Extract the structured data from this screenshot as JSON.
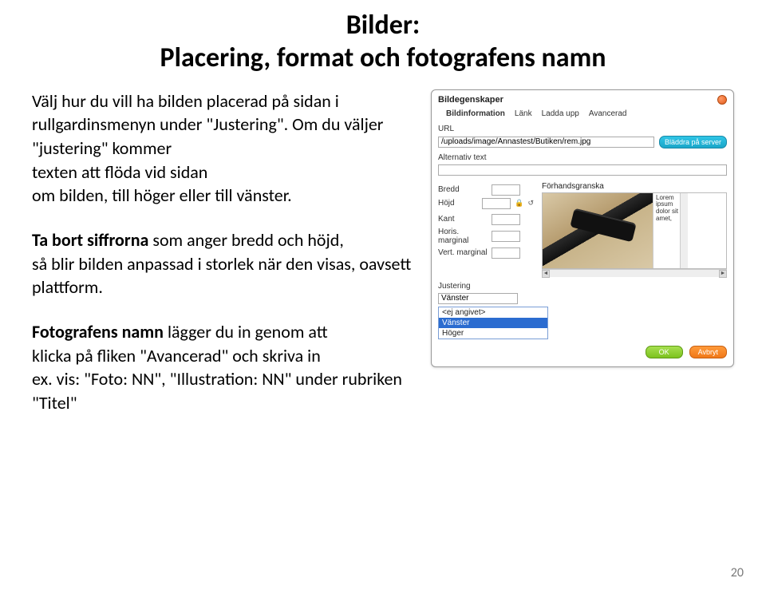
{
  "title": {
    "line1": "Bilder:",
    "line2": "Placering, format och fotografens namn"
  },
  "body": {
    "p1_plain_a": "Välj hur du vill ha bilden placerad på sidan i rullgardinsmenyn under \"Justering\". Om du väljer \"justering\" kommer",
    "p1_plain_b": "texten att flöda vid sidan",
    "p1_plain_c": "om bilden, till höger eller till vänster.",
    "p2_bold": "Ta bort siffrorna",
    "p2_rest_a": " som anger bredd och höjd,",
    "p2_rest_b": "så blir bilden anpassad i storlek när den visas, oavsett plattform.",
    "p3_bold": "Fotografens namn",
    "p3_rest_a": " lägger du in genom att",
    "p3_rest_b": "klicka på fliken \"Avancerad\" och skriva in",
    "p3_rest_c": "ex. vis: \"Foto: NN\", \"Illustration: NN\" under rubriken \"Titel\""
  },
  "dialog": {
    "title": "Bildegenskaper",
    "tabs": {
      "info": "Bildinformation",
      "link": "Länk",
      "upload": "Ladda upp",
      "advanced": "Avancerad"
    },
    "url_label": "URL",
    "url_value": "/uploads/image/Annastest/Butiken/rem.jpg",
    "browse_btn": "Bläddra på server",
    "alt_label": "Alternativ text",
    "alt_value": "",
    "width_label": "Bredd",
    "width_value": "",
    "height_label": "Höjd",
    "height_value": "",
    "border_label": "Kant",
    "border_value": "",
    "hmargin_label": "Horis. marginal",
    "hmargin_value": "",
    "vmargin_label": "Vert. marginal",
    "vmargin_value": "",
    "preview_label": "Förhandsgranska",
    "lorem": "Lorem ipsum dolor sit amet,",
    "justering_label": "Justering",
    "justering_selected": "Vänster",
    "justering_options": {
      "none": "<ej angivet>",
      "left": "Vänster",
      "right": "Höger"
    },
    "ok": "OK",
    "cancel": "Avbryt"
  },
  "page_number": "20"
}
